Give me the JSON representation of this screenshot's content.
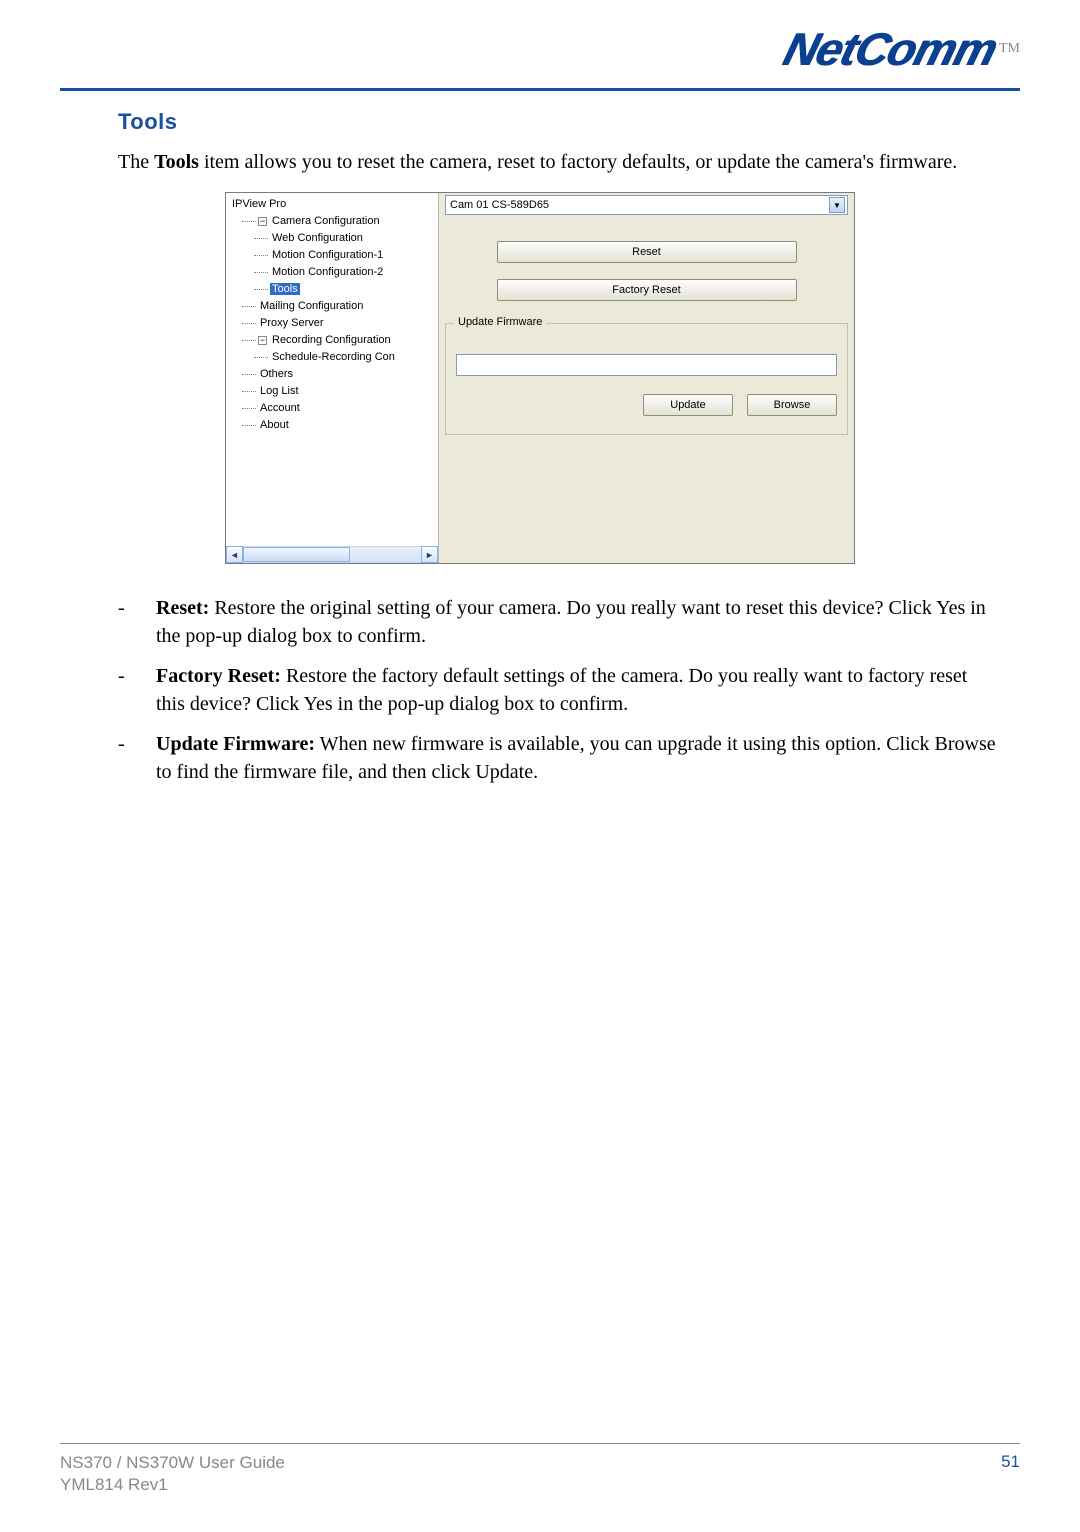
{
  "logo": {
    "text": "NetComm",
    "tm": "TM"
  },
  "section_title": "Tools",
  "intro_pre": "The ",
  "intro_bold": "Tools",
  "intro_post": " item allows you to reset the camera, reset to factory defaults, or update the camera's firmware.",
  "shot": {
    "tree": {
      "root": "IPView Pro",
      "cam_config": "Camera Configuration",
      "web_config": "Web Configuration",
      "motion1": "Motion Configuration-1",
      "motion2": "Motion Configuration-2",
      "tools": "Tools",
      "mailing": "Mailing Configuration",
      "proxy": "Proxy Server",
      "rec_config": "Recording Configuration",
      "sched": "Schedule-Recording Con",
      "others": "Others",
      "loglist": "Log List",
      "account": "Account",
      "about": "About"
    },
    "cam_select": "Cam 01    CS-589D65",
    "reset_label": "Reset",
    "factory_label": "Factory Reset",
    "group_title": "Update Firmware",
    "update_label": "Update",
    "browse_label": "Browse"
  },
  "bullets": [
    {
      "title": "Reset:",
      "text": " Restore the original setting of your camera.  Do you really want to reset this device?  Click Yes in the pop-up dialog box to confirm."
    },
    {
      "title": "Factory Reset:",
      "text": " Restore the factory default settings of the camera.  Do you really want to factory reset this device?  Click Yes in the pop-up dialog box to confirm."
    },
    {
      "title": "Update Firmware:",
      "text": " When new firmware is available, you can upgrade it using this option.  Click Browse to find the firmware file, and then click Update."
    }
  ],
  "footer": {
    "line1": "NS370 / NS370W User Guide",
    "line2": "YML814 Rev1",
    "page": "51"
  }
}
